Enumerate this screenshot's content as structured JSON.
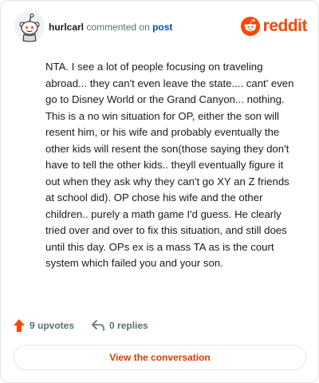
{
  "header": {
    "username": "hurlcarl",
    "action_text": "commented on",
    "post_link": "post",
    "brand_name": "reddit",
    "brand_color": "#ff4500",
    "avatar_icon": "snoo-avatar-icon"
  },
  "comment": {
    "text": "NTA. I see a lot of people focusing on traveling abroad... they can't even leave the state.... cant' even go to Disney World or the Grand Canyon... nothing. This is a no win situation for OP, either the son will resent him, or his wife and probably eventually the other kids will resent the son(those saying they don't have to tell the other kids.. theyll eventually figure it out when they ask why they can't go XY an Z friends at school did). OP chose his wife and the other children.. purely a math game I'd guess. He clearly tried over and over to fix this situation, and still does until this day. OPs ex is a mass TA as is the court system which failed you and your son."
  },
  "footer": {
    "upvotes_label": "9 upvotes",
    "replies_label": "0 replies",
    "upvote_icon": "upvote-arrow-icon",
    "reply_icon": "reply-arrow-icon"
  },
  "cta": {
    "label": "View the conversation"
  }
}
